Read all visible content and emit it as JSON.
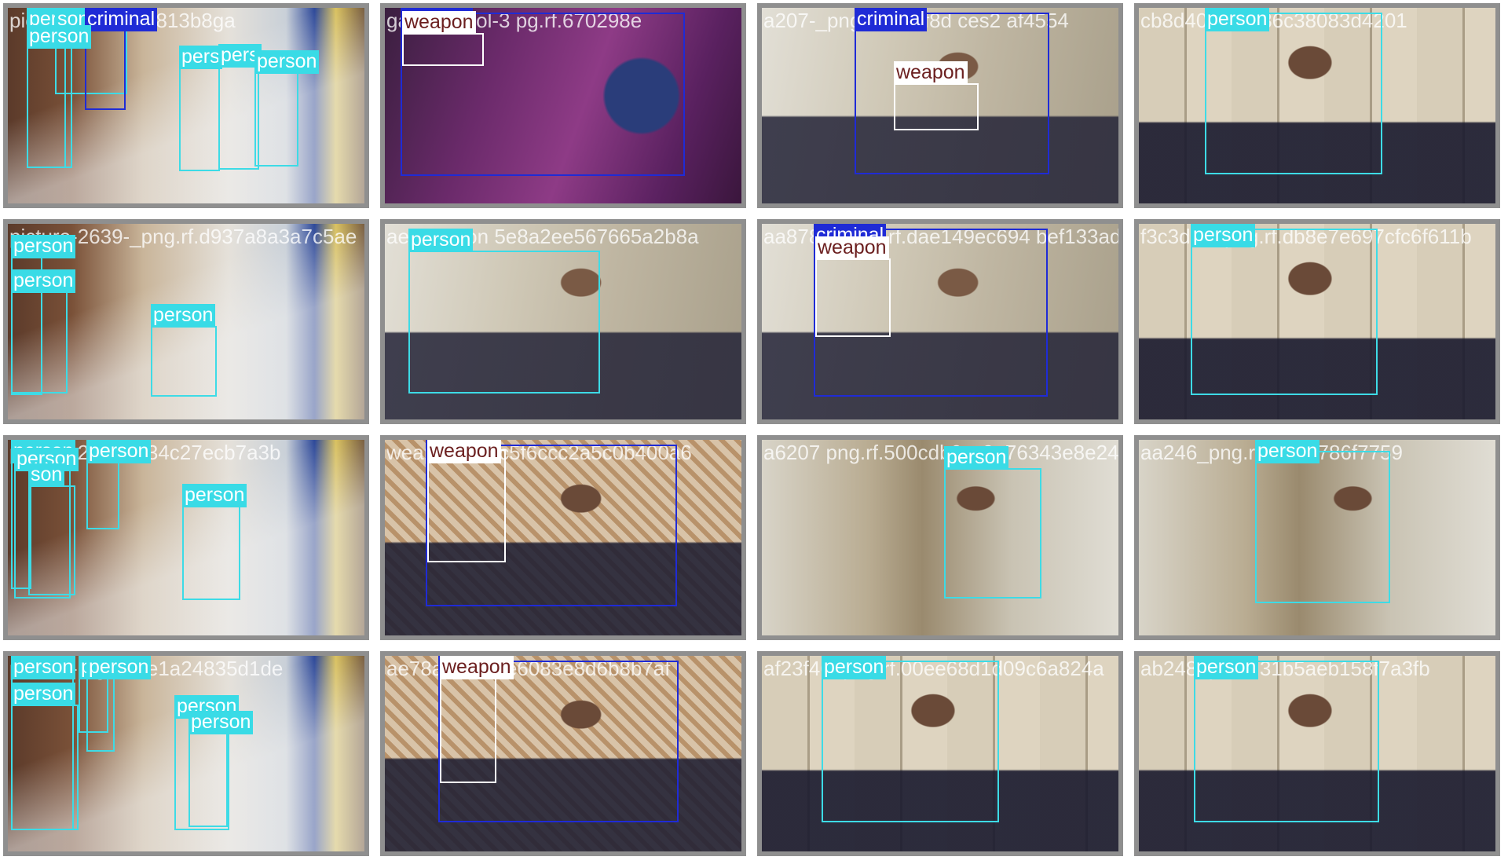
{
  "colors": {
    "person": "#39dbe6",
    "criminal": "#1f2bd6",
    "weapon": "#ffffff",
    "weapon_text": "#6b1f1f"
  },
  "tiles": [
    {
      "scene": "store",
      "caption": "pict         g.rf.f597862813b8ga",
      "labels": [
        "person",
        "son",
        "criminal",
        "person",
        "pers",
        "pers",
        "person"
      ]
    },
    {
      "scene": "range",
      "caption": "ga             air-pistol-3   pg.rf.670298e",
      "labels": [
        "criminal",
        "weapon"
      ]
    },
    {
      "scene": "room",
      "caption": "a207-_png     8f   676f8d     ces2   af4554",
      "labels": [
        "criminal",
        "weapon"
      ]
    },
    {
      "scene": "closet",
      "caption": "cb8d40_  ic3c86c38083d4201",
      "labels": [
        "person"
      ]
    },
    {
      "scene": "store",
      "caption": "picture-2639-_png.rf.d937a8a3a7c5ae",
      "labels": [
        "person",
        "person",
        "person"
      ]
    },
    {
      "scene": "room",
      "caption": "ae4   person    5e8a2ee567665a2b8a",
      "labels": [
        "person"
      ]
    },
    {
      "scene": "room",
      "caption": "aa87849   png.rf.dae149ec694    bef133ad84fb",
      "labels": [
        "criminal",
        "weapon"
      ]
    },
    {
      "scene": "closet",
      "caption": "f3c3d48_png.rf.db8e7e697cfc6f611b",
      "labels": [
        "person"
      ]
    },
    {
      "scene": "store",
      "caption": "picture-26   rf.d134c27ecb7a3b",
      "labels": [
        "person",
        "person",
        "person",
        "son",
        "person"
      ]
    },
    {
      "scene": "wall",
      "caption": "   weapon       f-96c5f6ccc2a5c0b400a6",
      "labels": [
        "criminal",
        "weapon"
      ]
    },
    {
      "scene": "door",
      "caption": "a6207   png.rf.500cdb0cc9a76343e8e2415",
      "labels": [
        "person"
      ]
    },
    {
      "scene": "door",
      "caption": "aa246_png.rf   ef04a786f7759",
      "labels": [
        "person"
      ]
    },
    {
      "scene": "store",
      "caption": "picture-2    g.rf.f4e1a24835d1de",
      "labels": [
        "person",
        "person",
        "person",
        "person",
        "person",
        "person"
      ]
    },
    {
      "scene": "wall",
      "caption": "ae78a      83360e6083e8d6b8b7af",
      "labels": [
        "criminal",
        "weapon"
      ]
    },
    {
      "scene": "closet",
      "caption": "af23f46_png.rf.00ee68d1d09c6a824a",
      "labels": [
        "person"
      ]
    },
    {
      "scene": "closet",
      "caption": "ab248_pn   5d31b5aeb158f7a3fb",
      "labels": [
        "person"
      ]
    }
  ]
}
